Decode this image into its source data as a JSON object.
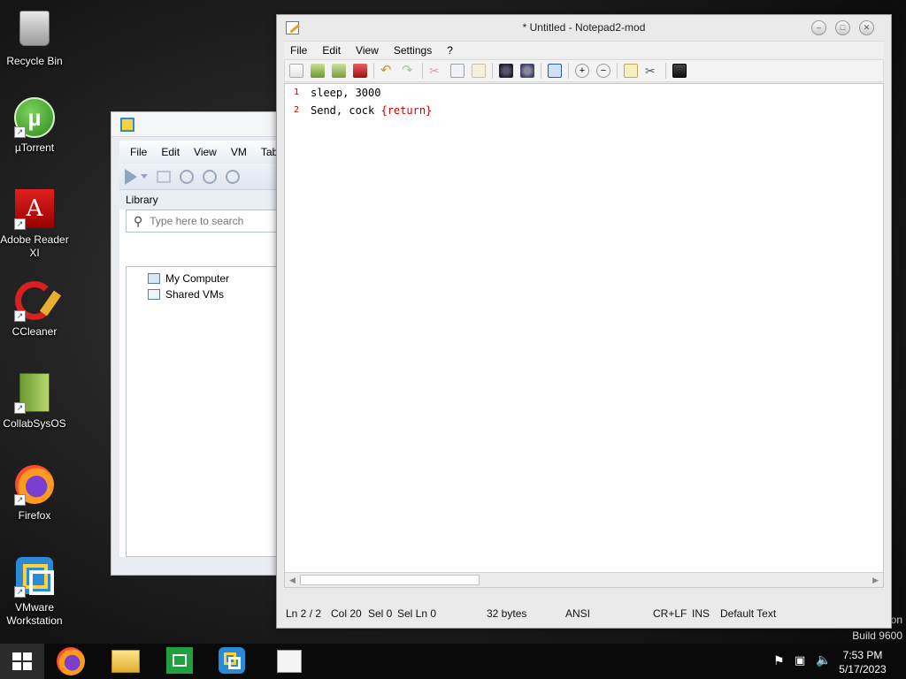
{
  "desktop": {
    "icons": [
      {
        "label": "Recycle Bin",
        "icon": "recycle-bin-icon"
      },
      {
        "label": "µTorrent",
        "icon": "utorrent-icon"
      },
      {
        "label": "Adobe Reader XI",
        "icon": "adobe-reader-icon"
      },
      {
        "label": "CCleaner",
        "icon": "ccleaner-icon"
      },
      {
        "label": "CollabSysOS",
        "icon": "collabsysos-icon"
      },
      {
        "label": "Firefox",
        "icon": "firefox-icon"
      },
      {
        "label": "VMware Workstation",
        "icon": "vmware-icon"
      }
    ],
    "watermark_partial": "on",
    "build": "Build 9600"
  },
  "vmware": {
    "menu": [
      "File",
      "Edit",
      "View",
      "VM",
      "Tabs"
    ],
    "library_label": "Library",
    "search_placeholder": "Type here to search",
    "tree": [
      "My Computer",
      "Shared VMs"
    ]
  },
  "notepad": {
    "title": "* Untitled - Notepad2-mod",
    "menu": [
      "File",
      "Edit",
      "View",
      "Settings",
      "?"
    ],
    "lines": [
      {
        "num": "1",
        "text": "sleep, 3000",
        "brace": ""
      },
      {
        "num": "2",
        "text": "Send, cock ",
        "brace": "{return}"
      }
    ],
    "status": {
      "line": "Ln 2 / 2",
      "col": "Col 20",
      "sel": "Sel 0",
      "sel_ln": "Sel Ln 0",
      "size": "32 bytes",
      "encoding": "ANSI",
      "eol": "CR+LF",
      "mode": "INS",
      "scheme": "Default Text"
    }
  },
  "taskbar": {
    "apps": [
      "firefox-icon",
      "file-explorer-icon",
      "store-icon",
      "vmware-icon",
      "notepad-icon"
    ],
    "time": "7:53 PM",
    "date": "5/17/2023"
  }
}
